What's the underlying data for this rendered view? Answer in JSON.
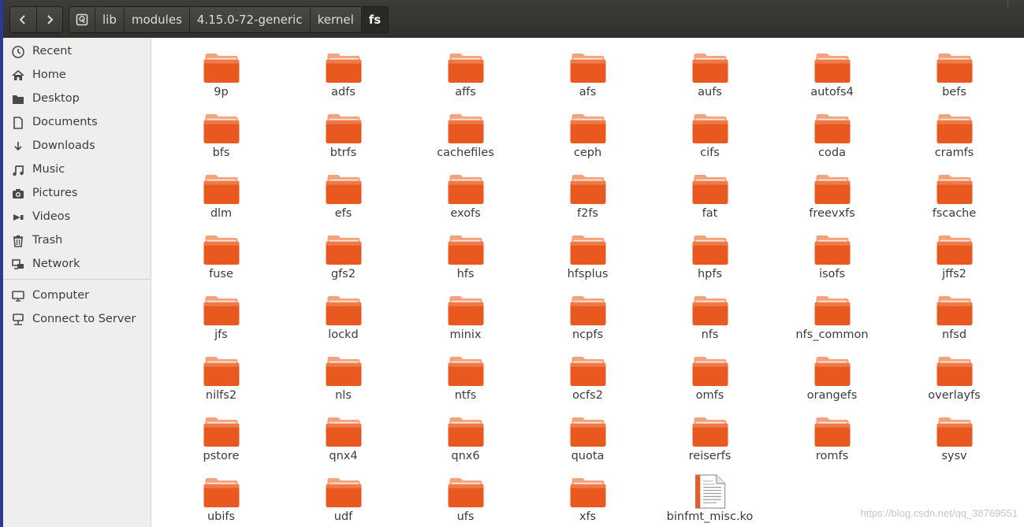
{
  "header": {
    "breadcrumbs": [
      "lib",
      "modules",
      "4.15.0-72-generic",
      "kernel",
      "fs"
    ],
    "active_index": 4
  },
  "sidebar": {
    "places": [
      {
        "label": "Recent",
        "icon": "clock-icon"
      },
      {
        "label": "Home",
        "icon": "home-icon"
      },
      {
        "label": "Desktop",
        "icon": "desktop-folder-icon"
      },
      {
        "label": "Documents",
        "icon": "document-icon"
      },
      {
        "label": "Downloads",
        "icon": "download-icon"
      },
      {
        "label": "Music",
        "icon": "music-icon"
      },
      {
        "label": "Pictures",
        "icon": "camera-icon"
      },
      {
        "label": "Videos",
        "icon": "video-icon"
      },
      {
        "label": "Trash",
        "icon": "trash-icon"
      },
      {
        "label": "Network",
        "icon": "network-icon"
      }
    ],
    "devices": [
      {
        "label": "Computer",
        "icon": "computer-icon"
      },
      {
        "label": "Connect to Server",
        "icon": "server-icon"
      }
    ]
  },
  "files": [
    {
      "name": "9p",
      "type": "folder"
    },
    {
      "name": "adfs",
      "type": "folder"
    },
    {
      "name": "affs",
      "type": "folder"
    },
    {
      "name": "afs",
      "type": "folder"
    },
    {
      "name": "aufs",
      "type": "folder"
    },
    {
      "name": "autofs4",
      "type": "folder"
    },
    {
      "name": "befs",
      "type": "folder"
    },
    {
      "name": "bfs",
      "type": "folder"
    },
    {
      "name": "btrfs",
      "type": "folder"
    },
    {
      "name": "cachefiles",
      "type": "folder"
    },
    {
      "name": "ceph",
      "type": "folder"
    },
    {
      "name": "cifs",
      "type": "folder"
    },
    {
      "name": "coda",
      "type": "folder"
    },
    {
      "name": "cramfs",
      "type": "folder"
    },
    {
      "name": "dlm",
      "type": "folder"
    },
    {
      "name": "efs",
      "type": "folder"
    },
    {
      "name": "exofs",
      "type": "folder"
    },
    {
      "name": "f2fs",
      "type": "folder"
    },
    {
      "name": "fat",
      "type": "folder"
    },
    {
      "name": "freevxfs",
      "type": "folder"
    },
    {
      "name": "fscache",
      "type": "folder"
    },
    {
      "name": "fuse",
      "type": "folder"
    },
    {
      "name": "gfs2",
      "type": "folder"
    },
    {
      "name": "hfs",
      "type": "folder"
    },
    {
      "name": "hfsplus",
      "type": "folder"
    },
    {
      "name": "hpfs",
      "type": "folder"
    },
    {
      "name": "isofs",
      "type": "folder"
    },
    {
      "name": "jffs2",
      "type": "folder"
    },
    {
      "name": "jfs",
      "type": "folder"
    },
    {
      "name": "lockd",
      "type": "folder"
    },
    {
      "name": "minix",
      "type": "folder"
    },
    {
      "name": "ncpfs",
      "type": "folder"
    },
    {
      "name": "nfs",
      "type": "folder"
    },
    {
      "name": "nfs_common",
      "type": "folder"
    },
    {
      "name": "nfsd",
      "type": "folder"
    },
    {
      "name": "nilfs2",
      "type": "folder"
    },
    {
      "name": "nls",
      "type": "folder"
    },
    {
      "name": "ntfs",
      "type": "folder"
    },
    {
      "name": "ocfs2",
      "type": "folder"
    },
    {
      "name": "omfs",
      "type": "folder"
    },
    {
      "name": "orangefs",
      "type": "folder"
    },
    {
      "name": "overlayfs",
      "type": "folder"
    },
    {
      "name": "pstore",
      "type": "folder"
    },
    {
      "name": "qnx4",
      "type": "folder"
    },
    {
      "name": "qnx6",
      "type": "folder"
    },
    {
      "name": "quota",
      "type": "folder"
    },
    {
      "name": "reiserfs",
      "type": "folder"
    },
    {
      "name": "romfs",
      "type": "folder"
    },
    {
      "name": "sysv",
      "type": "folder"
    },
    {
      "name": "ubifs",
      "type": "folder"
    },
    {
      "name": "udf",
      "type": "folder"
    },
    {
      "name": "ufs",
      "type": "folder"
    },
    {
      "name": "xfs",
      "type": "folder"
    },
    {
      "name": "binfmt_misc.ko",
      "type": "file"
    }
  ],
  "watermark": "https://blog.csdn.net/qq_38769551",
  "colors": {
    "folder_top": "#f5a27a",
    "folder_body": "#e85a24",
    "header_bg": "#3b3a36",
    "sidebar_bg": "#efeeed"
  }
}
